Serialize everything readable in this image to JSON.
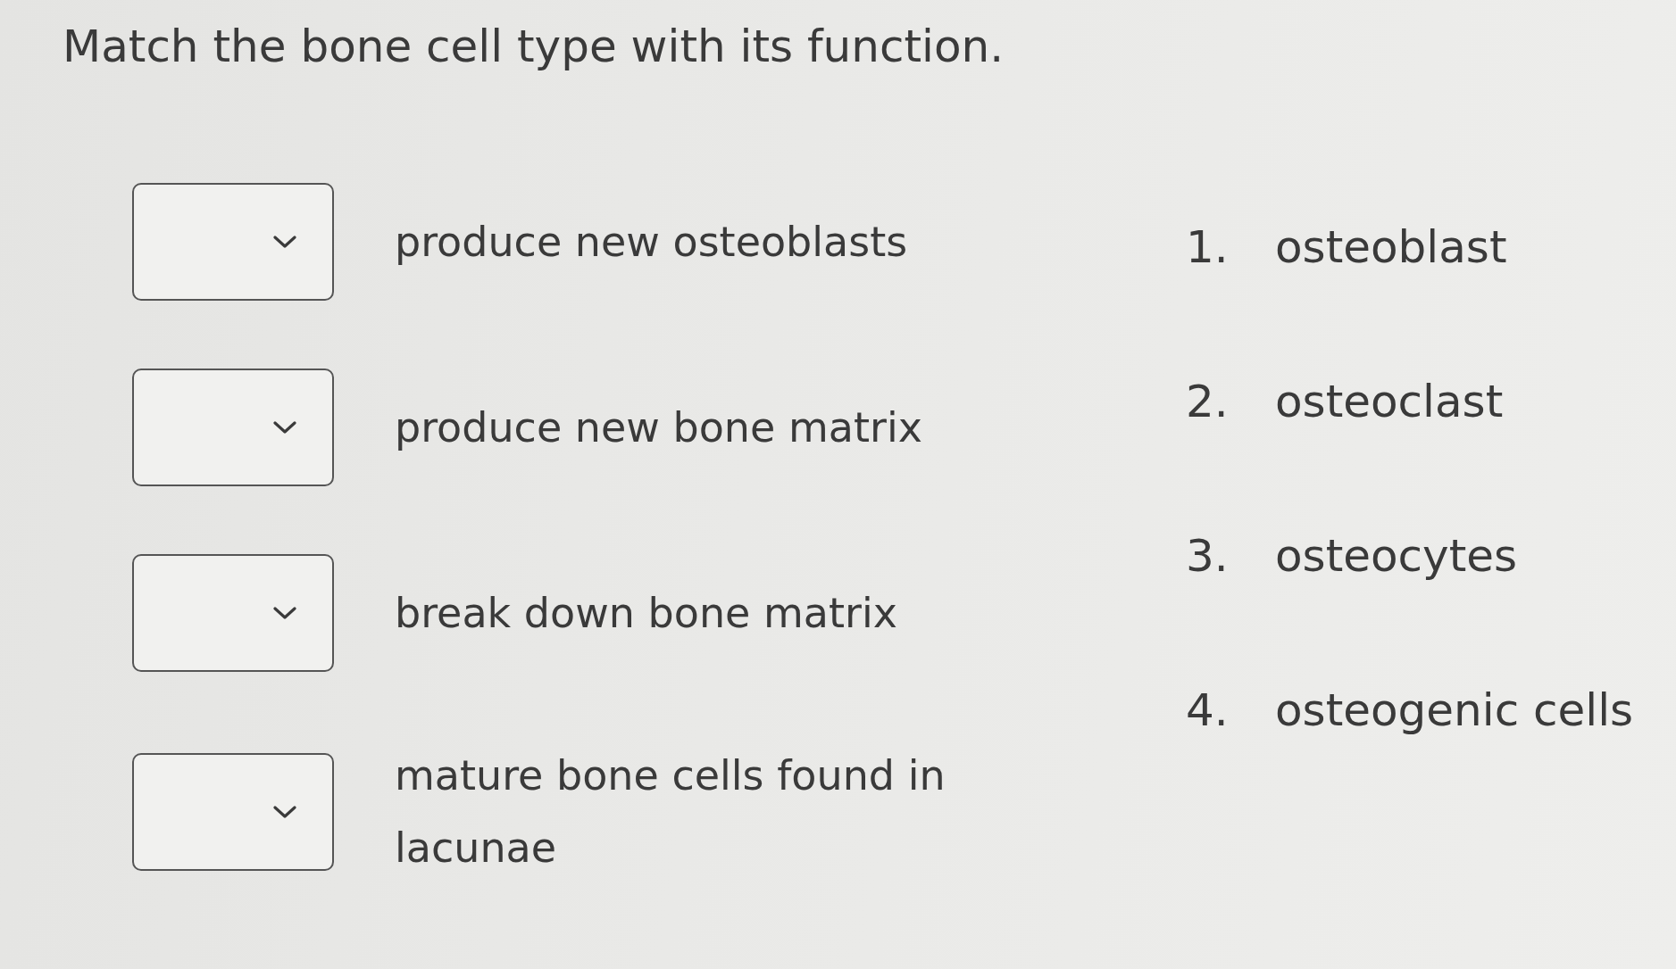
{
  "question": {
    "title": "Match the bone cell type with its function."
  },
  "functions": [
    {
      "text": "produce new osteoblasts"
    },
    {
      "text": "produce new bone matrix"
    },
    {
      "text": "break down bone matrix"
    },
    {
      "text": "mature bone cells found in lacunae"
    }
  ],
  "cell_types": [
    {
      "number": "1.",
      "name": "osteoblast"
    },
    {
      "number": "2.",
      "name": "osteoclast"
    },
    {
      "number": "3.",
      "name": "osteocytes"
    },
    {
      "number": "4.",
      "name": "osteogenic cells"
    }
  ]
}
